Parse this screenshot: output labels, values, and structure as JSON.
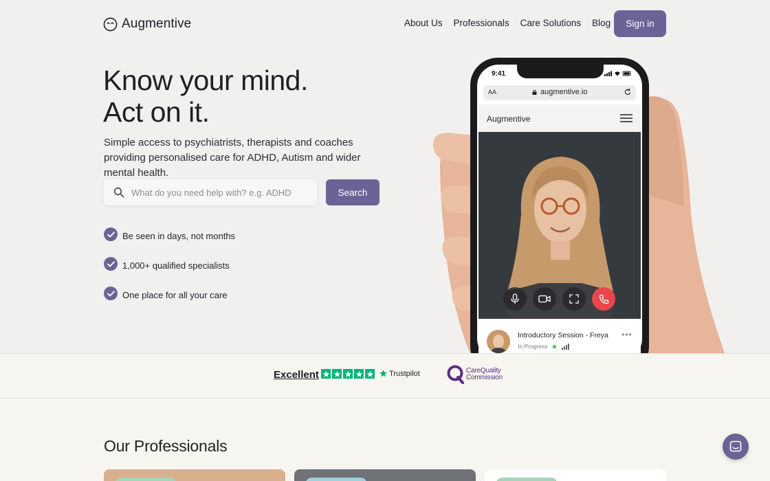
{
  "header": {
    "logo_text": "Augmentive",
    "nav": [
      "About Us",
      "Professionals",
      "Care Solutions",
      "Blog"
    ],
    "signin_label": "Sign in"
  },
  "hero": {
    "headline_line1": "Know your mind.",
    "headline_line2": "Act on it.",
    "subtext": "Simple access to psychiatrists, therapists and coaches providing personalised care for ADHD, Autism and wider mental health.",
    "search_placeholder": "What do you need help with? e.g. ADHD",
    "search_button": "Search",
    "features": [
      "Be seen in days, not months",
      "1,000+ qualified specialists",
      "One place for all your care"
    ]
  },
  "phone": {
    "time": "9:41",
    "url_aa": "AA",
    "url": "augmentive.io",
    "app_title": "Augmentive",
    "session_title": "Introductory Session - Freya",
    "session_status": "In Progress"
  },
  "trust": {
    "rating_word": "Excellent",
    "rating_stars": 5,
    "provider": "Trustpilot",
    "regulator_line1": "CareQuality",
    "regulator_line2": "Commission"
  },
  "professionals": {
    "title": "Our Professionals"
  },
  "colors": {
    "accent": "#6a6496",
    "trustpilot_green": "#00b67a",
    "cqc_purple": "#5b2d82",
    "end_call_red": "#e9474b"
  }
}
